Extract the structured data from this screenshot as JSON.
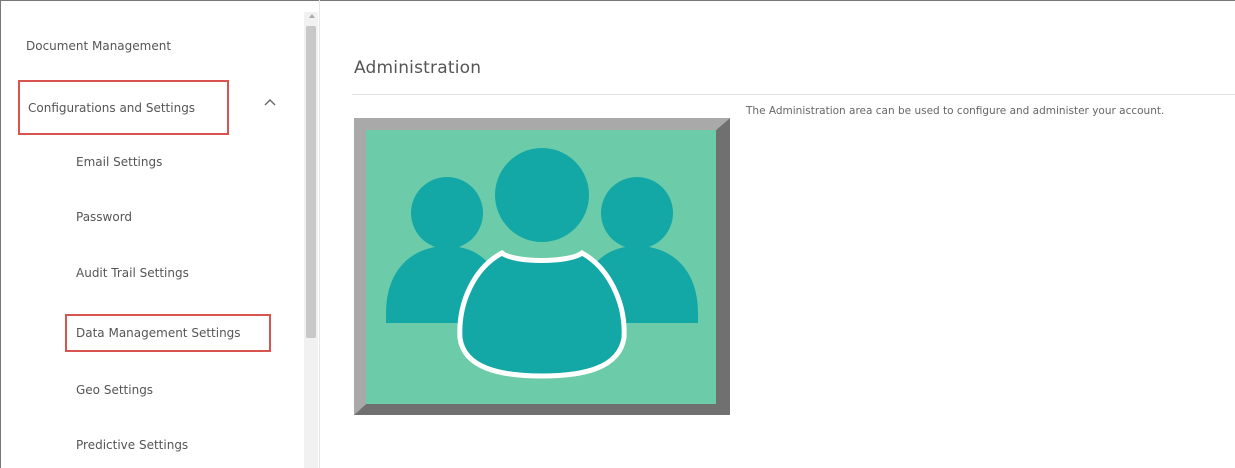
{
  "sidebar": {
    "top_item": "Document Management",
    "group": {
      "label": "Configurations and Settings",
      "expanded": true,
      "items": [
        "Email Settings",
        "Password",
        "Audit Trail Settings",
        "Data Management Settings",
        "Geo Settings",
        "Predictive Settings"
      ]
    }
  },
  "main": {
    "title": "Administration",
    "description": "The Administration area can be used to configure and administer your account.",
    "image_icon": "users-group-icon"
  },
  "colors": {
    "highlight_border": "#d9534f",
    "image_bg": "#6ccba9",
    "image_people": "#13a8a6",
    "image_frame_light": "#a9a9a9",
    "image_frame_dark": "#707070"
  }
}
